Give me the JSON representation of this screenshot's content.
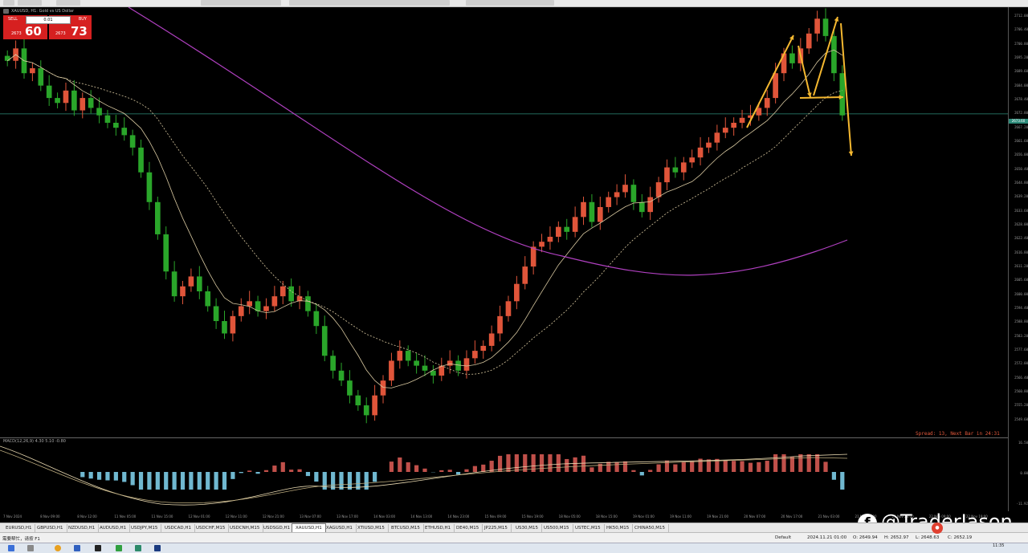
{
  "symbol": {
    "label": "XAUUSD, H1:  Gold vs US Dollar"
  },
  "trade_panel": {
    "sell_label": "SELL",
    "buy_label": "BUY",
    "lot": "0.01",
    "sell_price_small": "2673",
    "sell_price_big": "60",
    "buy_price_small": "2673",
    "buy_price_big": "73"
  },
  "spread_info": "Spread: 13, Next Bar in 24:31",
  "macd_label": "MACD(12,26,9) 4.30 5.10 -0.80",
  "price_axis": [
    "2712.00",
    "2706.40",
    "2700.80",
    "2695.20",
    "2689.60",
    "2684.00",
    "2678.40",
    "2672.80",
    "2667.20",
    "2661.60",
    "2656.00",
    "2650.40",
    "2644.80",
    "2639.20",
    "2633.60",
    "2628.00",
    "2622.40",
    "2616.80",
    "2611.20",
    "2605.60",
    "2600.00",
    "2594.40",
    "2588.80",
    "2583.20",
    "2577.60",
    "2572.00",
    "2566.40",
    "2560.80",
    "2555.20",
    "2549.60"
  ],
  "current_price_tag": "2673.60",
  "macd_axis": [
    "16.50",
    "0.00",
    "-11.92"
  ],
  "time_axis": [
    "7 Nov 2024",
    "8 Nov 09:00",
    "8 Nov 12:00",
    "11 Nov 05:00",
    "11 Nov 15:00",
    "12 Nov 01:00",
    "12 Nov 11:00",
    "12 Nov 21:00",
    "13 Nov 07:00",
    "13 Nov 17:00",
    "14 Nov 03:00",
    "14 Nov 13:00",
    "14 Nov 23:00",
    "15 Nov 09:00",
    "15 Nov 19:00",
    "18 Nov 05:00",
    "18 Nov 15:00",
    "19 Nov 01:00",
    "19 Nov 11:00",
    "19 Nov 21:00",
    "20 Nov 07:00",
    "20 Nov 17:00",
    "21 Nov 03:00",
    "21 Nov 13:00",
    "21 Nov 23:00",
    "22 Nov 09:00",
    "22 Nov 19:00"
  ],
  "tabs": [
    "EURUSD,H1",
    "GBPUSD,H1",
    "NZDUSD,H1",
    "AUDUSD,H1",
    "USDJPY,M15",
    "USDCAD,H1",
    "USDCHF,M15",
    "USDCNH,M15",
    "USDSGD,H1",
    "XAUUSD,H1",
    "XAGUSD,H1",
    "XTIUSD,M15",
    "BTCUSD,M15",
    "ETHUSD,H1",
    "DE40,M15",
    "JP225,M15",
    "US30,M15",
    "US500,M15",
    "USTEC,M15",
    "HK50,M15",
    "CHINA50,M15"
  ],
  "active_tab": "XAUUSD,H1",
  "status": {
    "help": "需要帮忙，请按 F1",
    "profile": "Default",
    "datetime": "2024.11.21 01:00",
    "open": "O: 2649.94",
    "high": "H: 2652.97",
    "low": "L: 2648.63",
    "close": "C: 2652.19"
  },
  "taskbar": {
    "time": "11:35"
  },
  "watermark": {
    "logo": "f",
    "text": "@TraderJason"
  },
  "colors": {
    "bull": "#e0553a",
    "bear": "#2aa62a",
    "ma_slow": "#b040c0",
    "ma_mid": "#d8c8a0",
    "arrow": "#f5b830",
    "hline": "#2e8b7a"
  },
  "chart_data": {
    "type": "candlestick",
    "instrument": "XAUUSD",
    "timeframe": "H1",
    "price_range": [
      2545,
      2715
    ],
    "current_price": 2673.6,
    "closes": [
      2695,
      2700,
      2690,
      2692,
      2685,
      2680,
      2678,
      2683,
      2675,
      2680,
      2676,
      2673,
      2670,
      2668,
      2665,
      2660,
      2650,
      2638,
      2625,
      2610,
      2600,
      2604,
      2608,
      2602,
      2596,
      2590,
      2585,
      2592,
      2596,
      2598,
      2594,
      2596,
      2600,
      2604,
      2598,
      2600,
      2594,
      2588,
      2576,
      2570,
      2566,
      2560,
      2556,
      2552,
      2560,
      2566,
      2574,
      2578,
      2574,
      2572,
      2570,
      2568,
      2572,
      2574,
      2570,
      2575,
      2578,
      2580,
      2585,
      2592,
      2598,
      2605,
      2612,
      2620,
      2622,
      2624,
      2628,
      2626,
      2632,
      2638,
      2630,
      2636,
      2640,
      2642,
      2645,
      2638,
      2634,
      2640,
      2646,
      2652,
      2650,
      2654,
      2656,
      2660,
      2662,
      2666,
      2668,
      2670,
      2672,
      2673,
      2676,
      2680,
      2690,
      2698,
      2694,
      2700,
      2706,
      2712,
      2705,
      2690,
      2673
    ]
  }
}
